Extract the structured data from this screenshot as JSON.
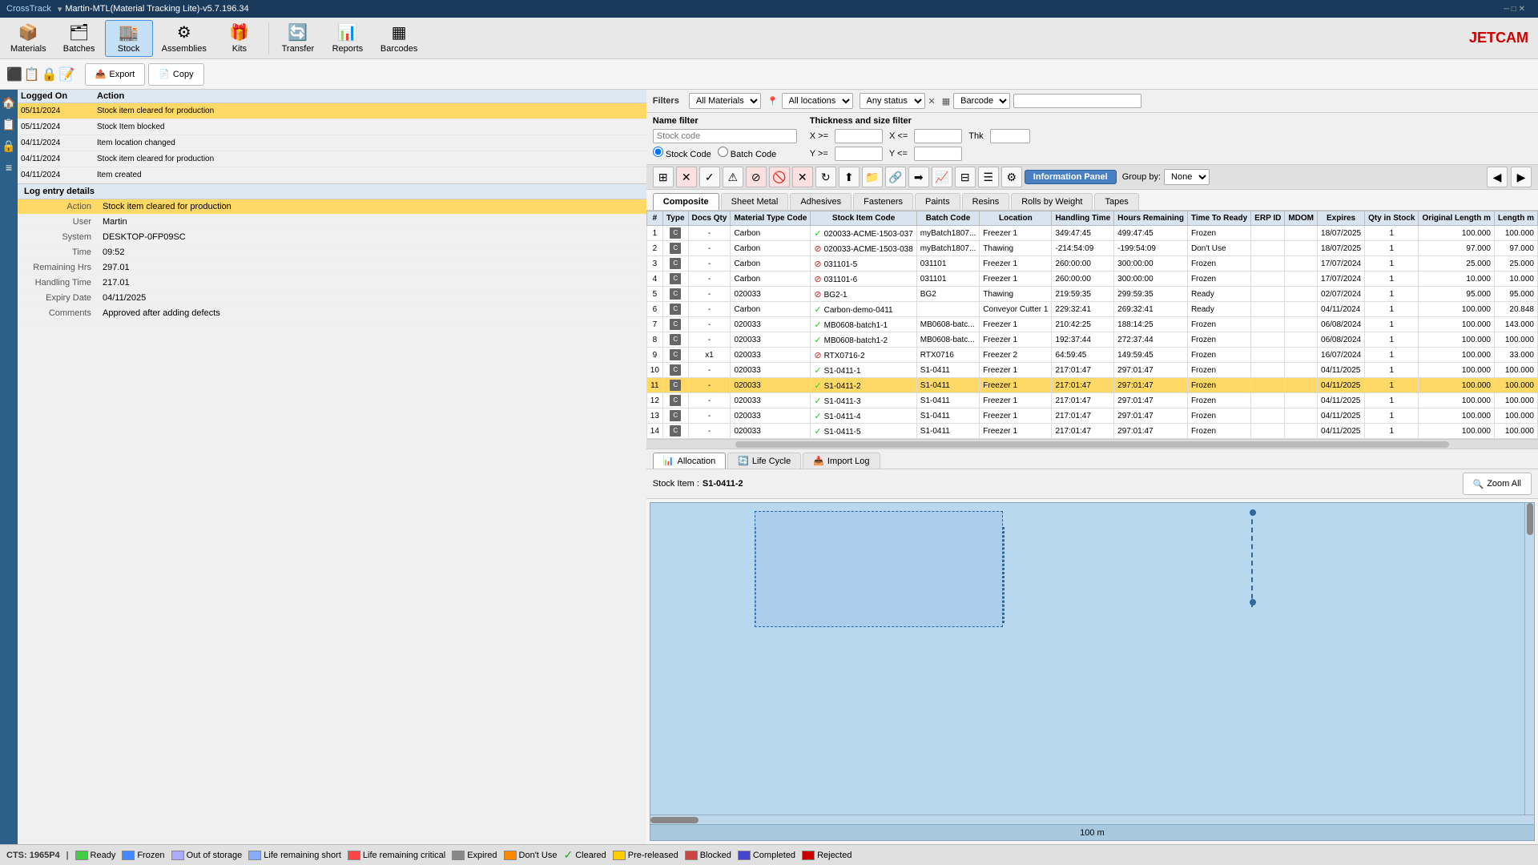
{
  "titleBar": {
    "appName": "CrossTrack",
    "title": "Martin-MTL(Material Tracking Lite)-v5.7.196.34"
  },
  "toolbar": {
    "buttons": [
      {
        "id": "materials",
        "label": "Materials",
        "icon": "📦"
      },
      {
        "id": "batches",
        "label": "Batches",
        "icon": "🗂"
      },
      {
        "id": "stock",
        "label": "Stock",
        "icon": "🏬"
      },
      {
        "id": "assemblies",
        "label": "Assemblies",
        "icon": "⚙"
      },
      {
        "id": "kits",
        "label": "Kits",
        "icon": "🎁"
      },
      {
        "id": "transfer",
        "label": "Transfer",
        "icon": "🔄"
      },
      {
        "id": "reports",
        "label": "Reports",
        "icon": "📊"
      },
      {
        "id": "barcodes",
        "label": "Barcodes",
        "icon": "▦"
      }
    ]
  },
  "actionBar": {
    "export": "Export",
    "copy": "Copy"
  },
  "filters": {
    "label": "Filters",
    "materialTypes": [
      "All Materials"
    ],
    "selectedMaterialType": "All Materials",
    "locations": [
      "All locations"
    ],
    "selectedLocation": "All locations",
    "statuses": [
      "Any status"
    ],
    "selectedStatus": "Any status",
    "barcodeLabel": "Barcode",
    "barcodeValue": ""
  },
  "nameFilter": {
    "label": "Name filter",
    "stockCodeLabel": "Stock code",
    "stockCodeValue": "",
    "stockCodeRadio": "Stock Code",
    "batchCodeRadio": "Batch Code"
  },
  "thicknessFilter": {
    "label": "Thickness and size filter",
    "xGte": "",
    "xLte": "",
    "tThk": "",
    "yGte": "",
    "yLte": ""
  },
  "infoPanel": {
    "label": "Information Panel"
  },
  "groupBy": {
    "label": "Group by:",
    "options": [
      "None"
    ],
    "selected": "None"
  },
  "tabs": [
    "Composite",
    "Sheet Metal",
    "Adhesives",
    "Fasteners",
    "Paints",
    "Resins",
    "Rolls by Weight",
    "Tapes"
  ],
  "tableHeaders": [
    "#",
    "Type",
    "Docs Qty",
    "Material Type Code",
    "Stock Item Code",
    "Batch Code",
    "Location",
    "Handling Time",
    "Hours Remaining",
    "Time To Ready",
    "ERP ID",
    "MDOM",
    "Expires",
    "Qty in Stock",
    "Original Length m",
    "Length m"
  ],
  "tableRows": [
    {
      "num": 1,
      "type": "C",
      "docs": "-",
      "matCode": "Carbon",
      "stockCode": "020033-ACME-1503-037",
      "batchCode": "myBatch1807...",
      "location": "Freezer 1",
      "handling": "349:47:45",
      "hours": "499:47:45",
      "timeReady": "Frozen",
      "erpId": "",
      "mdom": "",
      "expires": "18/07/2025",
      "qty": 1,
      "origLen": 100.0,
      "length": 100.0,
      "status": "green"
    },
    {
      "num": 2,
      "type": "C",
      "docs": "-",
      "matCode": "Carbon",
      "stockCode": "020033-ACME-1503-038",
      "batchCode": "myBatch1807...",
      "location": "Thawing",
      "handling": "-214:54:09",
      "hours": "-199:54:09",
      "timeReady": "Don't Use",
      "erpId": "",
      "mdom": "",
      "expires": "18/07/2025",
      "qty": 1,
      "origLen": 97.0,
      "length": 97.0,
      "status": "red"
    },
    {
      "num": 3,
      "type": "C",
      "docs": "-",
      "matCode": "Carbon",
      "stockCode": "031101-5",
      "batchCode": "031101",
      "location": "Freezer 1",
      "handling": "260:00:00",
      "hours": "300:00:00",
      "timeReady": "Frozen",
      "erpId": "",
      "mdom": "",
      "expires": "17/07/2024",
      "qty": 1,
      "origLen": 25.0,
      "length": 25.0,
      "status": "red"
    },
    {
      "num": 4,
      "type": "C",
      "docs": "-",
      "matCode": "Carbon",
      "stockCode": "031101-6",
      "batchCode": "031101",
      "location": "Freezer 1",
      "handling": "260:00:00",
      "hours": "300:00:00",
      "timeReady": "Frozen",
      "erpId": "",
      "mdom": "",
      "expires": "17/07/2024",
      "qty": 1,
      "origLen": 10.0,
      "length": 10.0,
      "status": "red"
    },
    {
      "num": 5,
      "type": "C",
      "docs": "-",
      "matCode": "020033",
      "stockCode": "BG2-1",
      "batchCode": "BG2",
      "location": "Thawing",
      "handling": "219:59:35",
      "hours": "299:59:35",
      "timeReady": "Ready",
      "erpId": "",
      "mdom": "",
      "expires": "02/07/2024",
      "qty": 1,
      "origLen": 95.0,
      "length": 95.0,
      "status": "red"
    },
    {
      "num": 6,
      "type": "C",
      "docs": "-",
      "matCode": "Carbon",
      "stockCode": "Carbon-demo-0411",
      "batchCode": "",
      "location": "Conveyor Cutter 1",
      "handling": "229:32:41",
      "hours": "269:32:41",
      "timeReady": "Ready",
      "erpId": "",
      "mdom": "",
      "expires": "04/11/2024",
      "qty": 1,
      "origLen": 100.0,
      "length": 20.848,
      "status": "green"
    },
    {
      "num": 7,
      "type": "C",
      "docs": "-",
      "matCode": "020033",
      "stockCode": "MB0608-batch1-1",
      "batchCode": "MB0608-batc...",
      "location": "Freezer 1",
      "handling": "210:42:25",
      "hours": "188:14:25",
      "timeReady": "Frozen",
      "erpId": "",
      "mdom": "",
      "expires": "06/08/2024",
      "qty": 1,
      "origLen": 100.0,
      "length": 143.0,
      "status": "green"
    },
    {
      "num": 8,
      "type": "C",
      "docs": "-",
      "matCode": "020033",
      "stockCode": "MB0608-batch1-2",
      "batchCode": "MB0608-batc...",
      "location": "Freezer 1",
      "handling": "192:37:44",
      "hours": "272:37:44",
      "timeReady": "Frozen",
      "erpId": "",
      "mdom": "",
      "expires": "06/08/2024",
      "qty": 1,
      "origLen": 100.0,
      "length": 100.0,
      "status": "green"
    },
    {
      "num": 9,
      "type": "C",
      "docs": "x1",
      "matCode": "020033",
      "stockCode": "RTX0716-2",
      "batchCode": "RTX0716",
      "location": "Freezer 2",
      "handling": "64:59:45",
      "hours": "149:59:45",
      "timeReady": "Frozen",
      "erpId": "",
      "mdom": "",
      "expires": "16/07/2024",
      "qty": 1,
      "origLen": 100.0,
      "length": 33.0,
      "status": "red"
    },
    {
      "num": 10,
      "type": "C",
      "docs": "-",
      "matCode": "020033",
      "stockCode": "S1-0411-1",
      "batchCode": "S1-0411",
      "location": "Freezer 1",
      "handling": "217:01:47",
      "hours": "297:01:47",
      "timeReady": "Frozen",
      "erpId": "",
      "mdom": "",
      "expires": "04/11/2025",
      "qty": 1,
      "origLen": 100.0,
      "length": 100.0,
      "status": "green"
    },
    {
      "num": 11,
      "type": "C",
      "docs": "-",
      "matCode": "020033",
      "stockCode": "S1-0411-2",
      "batchCode": "S1-0411",
      "location": "Freezer 1",
      "handling": "217:01:47",
      "hours": "297:01:47",
      "timeReady": "Frozen",
      "erpId": "",
      "mdom": "",
      "expires": "04/11/2025",
      "qty": 1,
      "origLen": 100.0,
      "length": 100.0,
      "status": "green",
      "selected": true
    },
    {
      "num": 12,
      "type": "C",
      "docs": "-",
      "matCode": "020033",
      "stockCode": "S1-0411-3",
      "batchCode": "S1-0411",
      "location": "Freezer 1",
      "handling": "217:01:47",
      "hours": "297:01:47",
      "timeReady": "Frozen",
      "erpId": "",
      "mdom": "",
      "expires": "04/11/2025",
      "qty": 1,
      "origLen": 100.0,
      "length": 100.0,
      "status": "green"
    },
    {
      "num": 13,
      "type": "C",
      "docs": "-",
      "matCode": "020033",
      "stockCode": "S1-0411-4",
      "batchCode": "S1-0411",
      "location": "Freezer 1",
      "handling": "217:01:47",
      "hours": "297:01:47",
      "timeReady": "Frozen",
      "erpId": "",
      "mdom": "",
      "expires": "04/11/2025",
      "qty": 1,
      "origLen": 100.0,
      "length": 100.0,
      "status": "green"
    },
    {
      "num": 14,
      "type": "C",
      "docs": "-",
      "matCode": "020033",
      "stockCode": "S1-0411-5",
      "batchCode": "S1-0411",
      "location": "Freezer 1",
      "handling": "217:01:47",
      "hours": "297:01:47",
      "timeReady": "Frozen",
      "erpId": "",
      "mdom": "",
      "expires": "04/11/2025",
      "qty": 1,
      "origLen": 100.0,
      "length": 100.0,
      "status": "green"
    }
  ],
  "logEntries": [
    {
      "date": "05/11/2024",
      "action": "Stock item cleared for production",
      "selected": true
    },
    {
      "date": "05/11/2024",
      "action": "Stock Item blocked"
    },
    {
      "date": "04/11/2024",
      "action": "Item location changed"
    },
    {
      "date": "04/11/2024",
      "action": "Stock item cleared for production"
    },
    {
      "date": "04/11/2024",
      "action": "Item created"
    }
  ],
  "logHeaders": {
    "loggedOn": "Logged On",
    "action": "Action"
  },
  "logDetails": {
    "header": "Log entry details",
    "properties": [
      {
        "key": "Action",
        "value": "Stock item cleared for production"
      },
      {
        "key": "User",
        "value": "Martin"
      },
      {
        "key": "System",
        "value": "DESKTOP-0FP09SC"
      },
      {
        "key": "Time",
        "value": "09:52"
      },
      {
        "key": "Remaining Hrs",
        "value": "297.01"
      },
      {
        "key": "Handling Time",
        "value": "217.01"
      },
      {
        "key": "Expiry Date",
        "value": "04/11/2025"
      },
      {
        "key": "Comments",
        "value": "Approved after adding defects"
      }
    ]
  },
  "bottomTabs": [
    "Allocation",
    "Life Cycle",
    "Import Log"
  ],
  "stockItemLabel": "Stock Item :",
  "stockItemValue": "S1-0411-2",
  "zoomAllLabel": "Zoom All",
  "vizRulerLabel": "100 m",
  "statusBar": {
    "coords": "CTS: 1965P4",
    "items": [
      {
        "color": "ready",
        "label": "Ready"
      },
      {
        "color": "frozen",
        "label": "Frozen"
      },
      {
        "color": "out-storage",
        "label": "Out of storage"
      },
      {
        "color": "life-short",
        "label": "Life remaining short"
      },
      {
        "color": "life-critical",
        "label": "Life remaining critical"
      },
      {
        "color": "expired",
        "label": "Expired"
      },
      {
        "color": "dont-use",
        "label": "Don't Use"
      },
      {
        "color": "cleared",
        "label": "Cleared"
      },
      {
        "color": "pre-released",
        "label": "Pre-released"
      },
      {
        "color": "blocked",
        "label": "Blocked"
      },
      {
        "color": "completed",
        "label": "Completed"
      },
      {
        "color": "rejected",
        "label": "Rejected"
      }
    ]
  }
}
